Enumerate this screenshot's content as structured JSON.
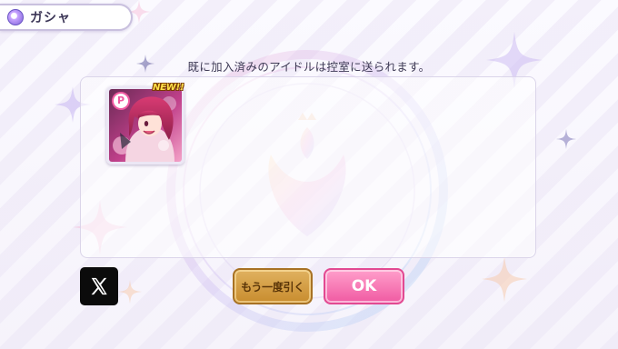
{
  "header": {
    "title": "ガシャ",
    "icon": "gacha-orb-icon"
  },
  "message": "既に加入済みのアイドルは控室に送られます。",
  "result_card": {
    "rarity_badge": "P",
    "new_label": "NEW!!",
    "icon": "idol-portrait"
  },
  "buttons": {
    "share_icon": "x-logo-icon",
    "again_label": "もう一度引く",
    "ok_label": "OK"
  },
  "colors": {
    "accent_pink": "#f05aa2",
    "gold_button": "#c88c2e",
    "header_border": "#c9c0de"
  }
}
